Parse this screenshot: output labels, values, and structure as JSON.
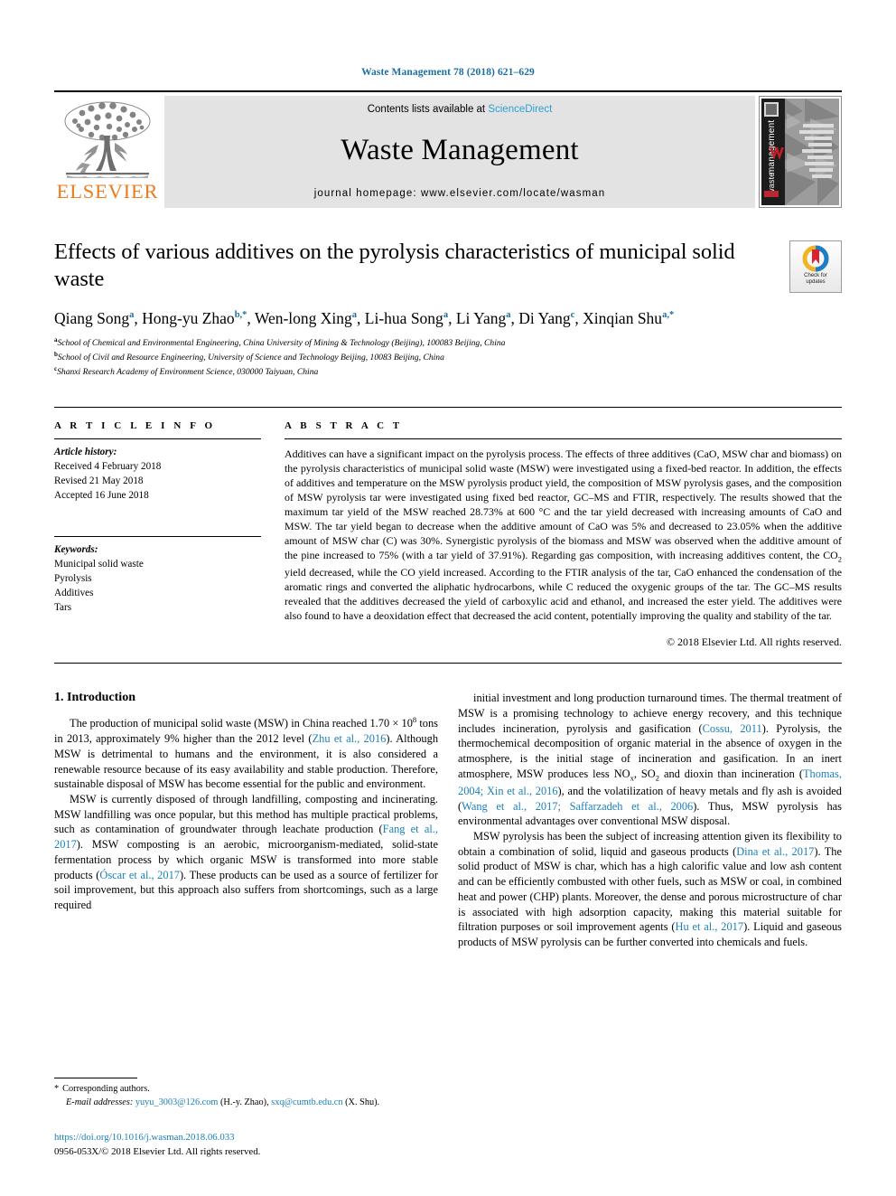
{
  "running_head": "Waste Management 78 (2018) 621–629",
  "masthead": {
    "elsevier_wordmark": "ELSEVIER",
    "contents_prefix": "Contents lists available at ",
    "contents_link": "ScienceDirect",
    "journal_title": "Waste Management",
    "homepage": "journal homepage: www.elsevier.com/locate/wasman",
    "cover_vertical_text": "waste management",
    "cover_items": [
      "GENERATION",
      "CHARACTERIZATION",
      "MINIMIZATION",
      "REUSE",
      "COLLECTION",
      "TRANSPORT",
      "TREATMENT",
      "DISPOSAL",
      "RECOVERY",
      "POLICY"
    ],
    "cover_footer": "IWWG"
  },
  "article": {
    "title": "Effects of various additives on the pyrolysis characteristics of municipal solid waste",
    "crossmark_line1": "Check for",
    "crossmark_line2": "updates",
    "authors": [
      {
        "name": "Qiang Song",
        "sup": "a",
        "sep": ", "
      },
      {
        "name": "Hong-yu Zhao",
        "sup": "b,*",
        "sep": ", "
      },
      {
        "name": "Wen-long Xing",
        "sup": "a",
        "sep": ", "
      },
      {
        "name": "Li-hua Song",
        "sup": "a",
        "sep": ", "
      },
      {
        "name": "Li Yang",
        "sup": "a",
        "sep": ", "
      },
      {
        "name": "Di Yang",
        "sup": "c",
        "sep": ", "
      },
      {
        "name": "Xinqian Shu",
        "sup": "a,*",
        "sep": ""
      }
    ],
    "affiliations": [
      {
        "marker": "a",
        "text": "School of Chemical and Environmental Engineering, China University of Mining & Technology (Beijing), 100083 Beijing, China"
      },
      {
        "marker": "b",
        "text": "School of Civil and Resource Engineering, University of Science and Technology Beijing, 10083 Beijing, China"
      },
      {
        "marker": "c",
        "text": "Shanxi Research Academy of Environment Science, 030000 Taiyuan, China"
      }
    ]
  },
  "article_info": {
    "heading": "A R T I C L E   I N F O",
    "history_label": "Article history:",
    "history": [
      "Received 4 February 2018",
      "Revised 21 May 2018",
      "Accepted 16 June 2018"
    ],
    "keywords_label": "Keywords:",
    "keywords": [
      "Municipal solid waste",
      "Pyrolysis",
      "Additives",
      "Tars"
    ]
  },
  "abstract": {
    "heading": "A B S T R A C T",
    "text": "Additives can have a significant impact on the pyrolysis process. The effects of three additives (CaO, MSW char and biomass) on the pyrolysis characteristics of municipal solid waste (MSW) were investigated using a fixed-bed reactor. In addition, the effects of additives and temperature on the MSW pyrolysis product yield, the composition of MSW pyrolysis gases, and the composition of MSW pyrolysis tar were investigated using fixed bed reactor, GC–MS and FTIR, respectively. The results showed that the maximum tar yield of the MSW reached 28.73% at 600 °C and the tar yield decreased with increasing amounts of CaO and MSW. The tar yield began to decrease when the additive amount of CaO was 5% and decreased to 23.05% when the additive amount of MSW char (C) was 30%. Synergistic pyrolysis of the biomass and MSW was observed when the additive amount of the pine increased to 75% (with a tar yield of 37.91%). Regarding gas composition, with increasing additives content, the CO2 yield decreased, while the CO yield increased. According to the FTIR analysis of the tar, CaO enhanced the condensation of the aromatic rings and converted the aliphatic hydrocarbons, while C reduced the oxygenic groups of the tar. The GC–MS results revealed that the additives decreased the yield of carboxylic acid and ethanol, and increased the ester yield. The additives were also found to have a deoxidation effect that decreased the acid content, potentially improving the quality and stability of the tar.",
    "copyright": "© 2018 Elsevier Ltd. All rights reserved."
  },
  "intro": {
    "heading": "1. Introduction",
    "left_paragraphs": [
      "The production of municipal solid waste (MSW) in China reached 1.70 × 10⁸ tons in 2013, approximately 9% higher than the 2012 level (Zhu et al., 2016). Although MSW is detrimental to humans and the environment, it is also considered a renewable resource because of its easy availability and stable production. Therefore, sustainable disposal of MSW has become essential for the public and environment.",
      "MSW is currently disposed of through landfilling, composting and incinerating. MSW landfilling was once popular, but this method has multiple practical problems, such as contamination of groundwater through leachate production (Fang et al., 2017). MSW composting is an aerobic, microorganism-mediated, solid-state fermentation process by which organic MSW is transformed into more stable products (Óscar et al., 2017). These products can be used as a source of fertilizer for soil improvement, but this approach also suffers from shortcomings, such as a large required"
    ],
    "right_paragraphs": [
      "initial investment and long production turnaround times. The thermal treatment of MSW is a promising technology to achieve energy recovery, and this technique includes incineration, pyrolysis and gasification (Cossu, 2011). Pyrolysis, the thermochemical decomposition of organic material in the absence of oxygen in the atmosphere, is the initial stage of incineration and gasification. In an inert atmosphere, MSW produces less NOx, SO2 and dioxin than incineration (Thomas, 2004; Xin et al., 2016), and the volatilization of heavy metals and fly ash is avoided (Wang et al., 2017; Saffarzadeh et al., 2006). Thus, MSW pyrolysis has environmental advantages over conventional MSW disposal.",
      "MSW pyrolysis has been the subject of increasing attention given its flexibility to obtain a combination of solid, liquid and gaseous products (Dina et al., 2017). The solid product of MSW is char, which has a high calorific value and low ash content and can be efficiently combusted with other fuels, such as MSW or coal, in combined heat and power (CHP) plants. Moreover, the dense and porous microstructure of char is associated with high adsorption capacity, making this material suitable for filtration purposes or soil improvement agents (Hu et al., 2017). Liquid and gaseous products of MSW pyrolysis can be further converted into chemicals and fuels."
    ]
  },
  "footnotes": {
    "corresponding": "Corresponding authors.",
    "email_label": "E-mail addresses:",
    "email1": "yuyu_3003@126.com",
    "email1_who": "(H.-y. Zhao)",
    "email2": "sxq@cumtb.edu.cn",
    "email2_who": "(X. Shu).",
    "doi": "https://doi.org/10.1016/j.wasman.2018.06.033",
    "issn_line": "0956-053X/© 2018 Elsevier Ltd. All rights reserved."
  },
  "colors": {
    "link_blue": "#1a80b8",
    "head_blue": "#1a6fa3",
    "sciencedirect_blue": "#2e9fd4",
    "elsevier_orange": "#ec7b1c",
    "banner_gray": "#e3e3e3"
  }
}
